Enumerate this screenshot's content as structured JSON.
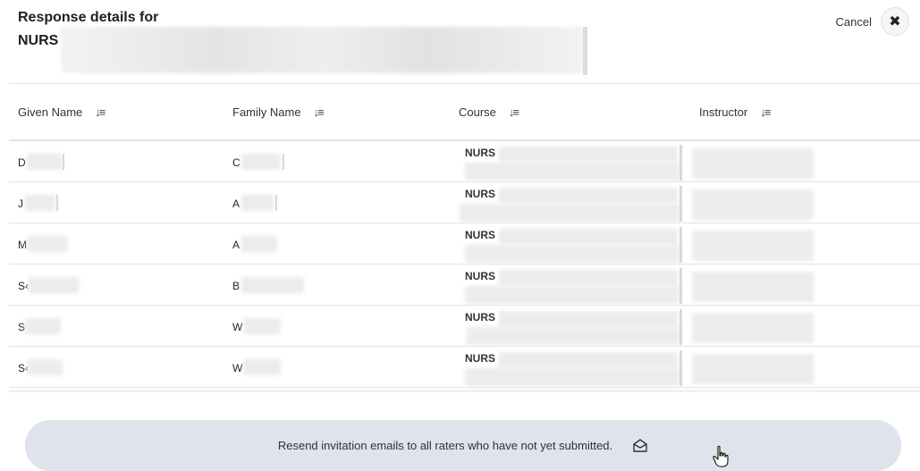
{
  "header": {
    "title_line1": "Response details for",
    "title_line2": "NURS"
  },
  "cancel": {
    "label": "Cancel",
    "close_icon": "✖"
  },
  "table": {
    "columns": [
      {
        "label": "Given Name",
        "sort_icon": "sort-icon"
      },
      {
        "label": "Family Name",
        "sort_icon": "sort-icon"
      },
      {
        "label": "Course",
        "sort_icon": "sort-icon"
      },
      {
        "label": "Instructor",
        "sort_icon": "sort-icon"
      }
    ],
    "sort_glyph": "↓≡",
    "rows": [
      {
        "given": "D",
        "family": "C",
        "course": "NURS"
      },
      {
        "given": "J",
        "family": "A",
        "course": "NURS"
      },
      {
        "given": "M",
        "family": "A",
        "course": "NURS"
      },
      {
        "given": "S‹",
        "family": "B",
        "course": "NURS"
      },
      {
        "given": "S",
        "family": "W",
        "course": "NURS"
      },
      {
        "given": "S‹",
        "family": "W",
        "course": "NURS"
      }
    ]
  },
  "resend": {
    "label": "Resend invitation emails to all raters who have not yet submitted.",
    "icon": "envelope-open-icon"
  }
}
